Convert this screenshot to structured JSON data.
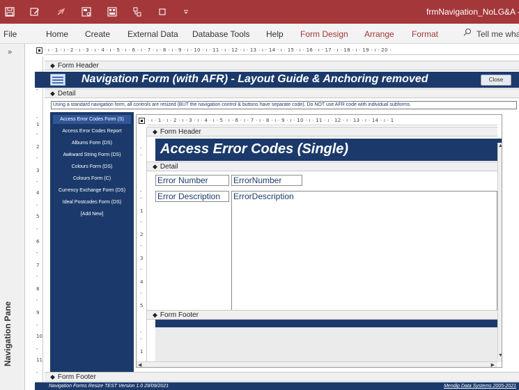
{
  "window": {
    "title": "frmNavigation_NoLG&A -"
  },
  "ribbon": {
    "tabs": [
      "File",
      "Home",
      "Create",
      "External Data",
      "Database Tools",
      "Help",
      "Form Design",
      "Arrange",
      "Format"
    ],
    "tell_me": "Tell me wha"
  },
  "nav_pane": {
    "label": "Navigation Pane",
    "chevron": "»"
  },
  "icons": {
    "save": "save-icon",
    "edit": "pencil-icon",
    "undo": "undo-icon",
    "form": "form-icon",
    "report": "report-icon",
    "relationships": "relationships-icon",
    "view": "view-icon",
    "customize": "chevron-down-icon",
    "search": "search-icon"
  },
  "ruler": {
    "outer": "· ı · 1 · ı · 2 · ı · 3 · ı · 4 · ı · 5 · ı · 6 · ı · 7 · ı · 8 · ı · 9 · ı · 10 · ı · 11 · ı · 12 · ı · 13 · ı · 14 · ı · 15 · ı · 16 · ı · 17 · ı · 18 · ı · 19 · ı · 20 ·",
    "inner": "· ı · 1 · ı · 2 · ı · 3 · ı · 4 · ı · 5 · ı · 6 · ı · 7 · ı · 8 · ı · 9 · ı · 10 · ı · 11 · ı · 12 · ı · 13 · ı · 14 · ı · 1"
  },
  "outer_form": {
    "header_label": "Form Header",
    "title": "Navigation Form (with AFR) - Layout Guide & Anchoring removed",
    "close_button": "Close",
    "detail_label": "Detail",
    "info_text": "Using a standard navigation form, all controls are resized (BUT the navigation control & buttons have separate code).     Do NOT use AFR code with individual subforms.",
    "footer_label": "Form Footer",
    "footer_left": "Navigation Forms Resize TEST  Version 1.0  29/09/2021",
    "footer_right": "Mendip Data Systems 2005-2021"
  },
  "nav_buttons": [
    "Access Error Codes Form (S)",
    "Access Error Codes Report",
    "Albums Form (DS)",
    "Awkward String Form (DS)",
    "Colours Form (DS)",
    "Colours Form (C)",
    "Currency Exchange Form (DS)",
    "Ideal Postcodes Form (DS)",
    "[Add New]"
  ],
  "subform": {
    "header_label": "Form Header",
    "title": "Access Error Codes (Single)",
    "detail_label": "Detail",
    "fields": [
      {
        "label": "Error Number",
        "control": "ErrorNumber"
      },
      {
        "label": "Error Description",
        "control": "ErrorDescription"
      }
    ],
    "footer_label": "Form Footer"
  },
  "scroll": {
    "up": "▲",
    "down": "▼",
    "left": "◀",
    "right": "▶"
  }
}
